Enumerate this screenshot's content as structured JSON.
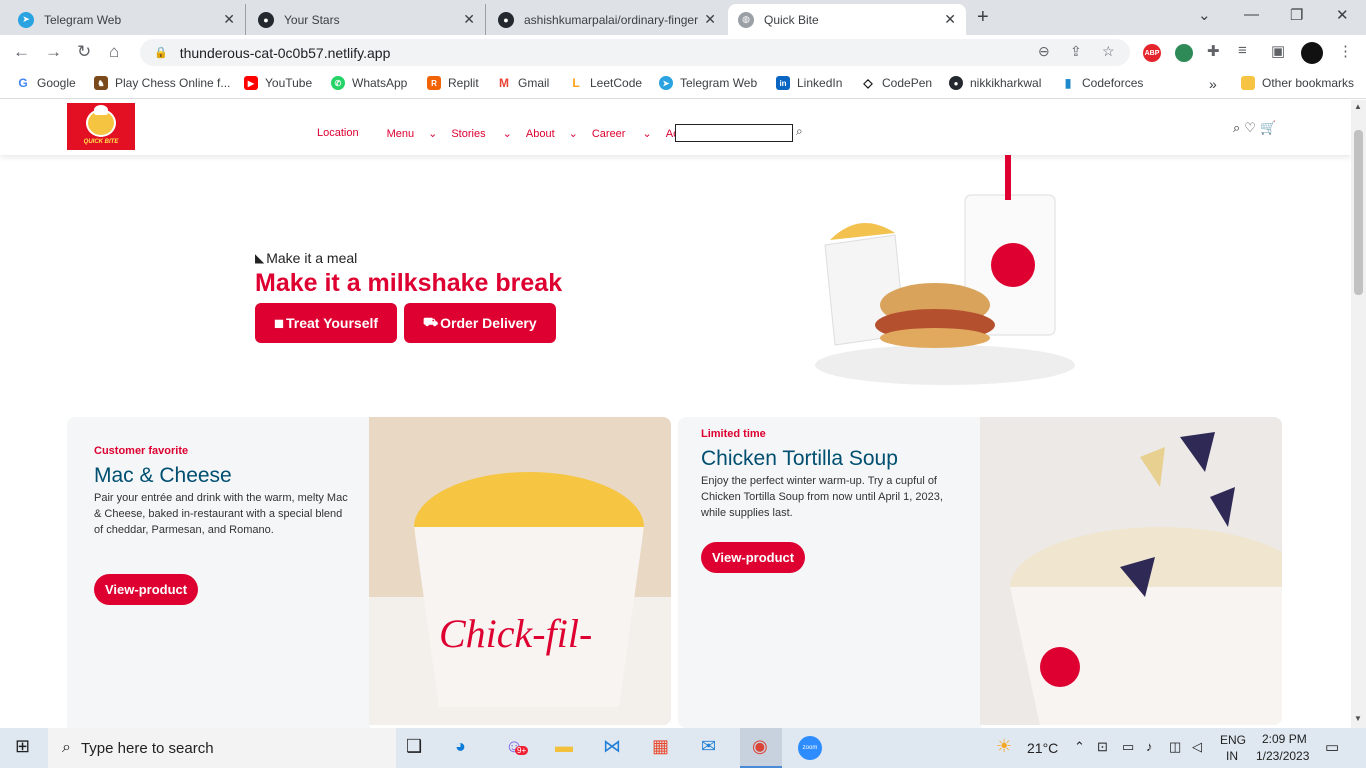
{
  "browser": {
    "tabs": [
      {
        "title": "Telegram Web",
        "icon": "telegram-icon",
        "color": "#2aa3e0"
      },
      {
        "title": "Your Stars",
        "icon": "github-icon",
        "color": "#24292f"
      },
      {
        "title": "ashishkumarpalai/ordinary-finger",
        "icon": "github-icon",
        "color": "#24292f"
      },
      {
        "title": "Quick Bite",
        "icon": "globe-icon",
        "color": "#5f6368"
      }
    ],
    "new_tab": "+",
    "url": "thunderous-cat-0c0b57.netlify.app",
    "bookmarks": [
      {
        "label": "Google",
        "color": "#4285f4",
        "glyph": "G"
      },
      {
        "label": "Play Chess Online f...",
        "color": "#7a4a1c",
        "glyph": "♞"
      },
      {
        "label": "YouTube",
        "color": "#ff0000",
        "glyph": "▶"
      },
      {
        "label": "WhatsApp",
        "color": "#25d366",
        "glyph": "✆"
      },
      {
        "label": "Replit",
        "color": "#f26207",
        "glyph": "R"
      },
      {
        "label": "Gmail",
        "color": "#ea4335",
        "glyph": "M"
      },
      {
        "label": "LeetCode",
        "color": "#ffa116",
        "glyph": "L"
      },
      {
        "label": "Telegram Web",
        "color": "#2aa3e0",
        "glyph": "➤"
      },
      {
        "label": "LinkedIn",
        "color": "#0a66c2",
        "glyph": "in"
      },
      {
        "label": "CodePen",
        "color": "#111111",
        "glyph": "◇"
      },
      {
        "label": "nikkikharkwal",
        "color": "#24292f",
        "glyph": "●"
      },
      {
        "label": "Codeforces",
        "color": "#1f8acb",
        "glyph": "▮"
      }
    ],
    "bookmarks_more": "»",
    "other_bookmarks": "Other bookmarks",
    "extensions": [
      {
        "label": "ABP",
        "color": "#e4262c"
      },
      {
        "label": "",
        "color": "#2e8b57"
      }
    ]
  },
  "site": {
    "logo_text": "QUICK BITE",
    "nav": [
      "Location",
      "Menu",
      "Stories",
      "About",
      "Career",
      "Account"
    ],
    "search_placeholder": ""
  },
  "hero": {
    "subtitle": "Make it a meal",
    "title": "Make it a milkshake break",
    "buttons": [
      "Treat Yourself",
      "Order Delivery"
    ]
  },
  "cards": [
    {
      "tag": "Customer favorite",
      "name": "Mac & Cheese",
      "description": "Pair your entrée and drink with the warm, melty Mac & Cheese, baked in-restaurant with a special blend of cheddar, Parmesan, and Romano.",
      "button": "View-product"
    },
    {
      "tag": "Limited time",
      "name": "Chicken Tortilla Soup",
      "description": "Enjoy the perfect winter warm-up. Try a cupful of Chicken Tortilla Soup from now until April 1, 2023, while supplies last.",
      "button": "View-product"
    }
  ],
  "taskbar": {
    "search_placeholder": "Type here to search",
    "weather": "21°C",
    "lang_top": "ENG",
    "lang_bottom": "IN",
    "time": "2:09 PM",
    "date": "1/23/2023",
    "badge": "9+"
  }
}
